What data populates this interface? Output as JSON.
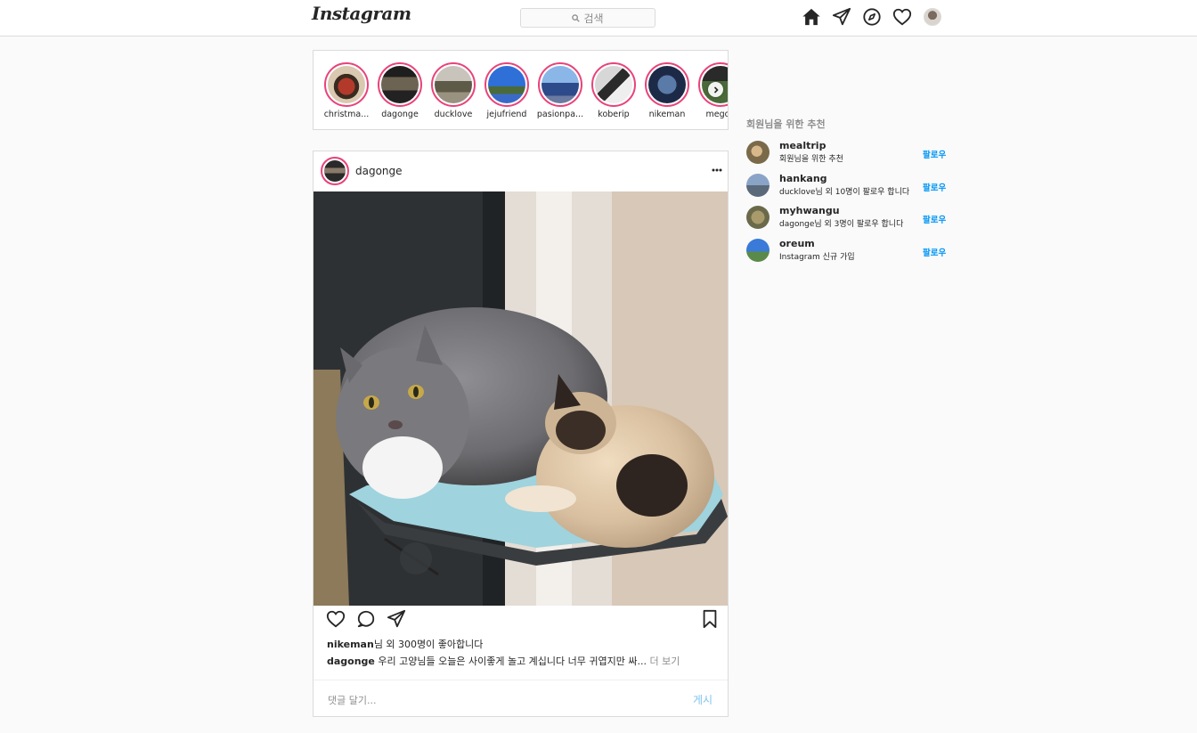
{
  "nav": {
    "logo": "Instagram",
    "search_placeholder": "검색",
    "icons": [
      "home-icon",
      "direct-icon",
      "explore-icon",
      "activity-icon",
      "profile-avatar"
    ]
  },
  "stories": [
    {
      "name": "christma..."
    },
    {
      "name": "dagonge"
    },
    {
      "name": "ducklove"
    },
    {
      "name": "jejufriend"
    },
    {
      "name": "pasionpa..."
    },
    {
      "name": "koberip"
    },
    {
      "name": "nikeman"
    },
    {
      "name": "megod"
    }
  ],
  "post": {
    "username": "dagonge",
    "likes_user": "nikeman",
    "likes_rest": "님 외 300명이 좋아합니다",
    "caption_user": "dagonge",
    "caption_text": " 우리 고양님들 오늘은 사이좋게 놀고 계십니다 너무 귀엽지만 싸...",
    "caption_more": " 더 보기",
    "comment_placeholder": "댓글 달기...",
    "comment_submit": "게시"
  },
  "suggestions": {
    "title": "회원님을 위한 추천",
    "items": [
      {
        "name": "mealtrip",
        "desc": "회원님을 위한 추천",
        "follow": "팔로우"
      },
      {
        "name": "hankang",
        "desc": "ducklove님 외 10명이 팔로우 합니다",
        "follow": "팔로우"
      },
      {
        "name": "myhwangu",
        "desc": "dagonge님 외 3명이 팔로우 합니다",
        "follow": "팔로우"
      },
      {
        "name": "oreum",
        "desc": "Instagram 신규 가입",
        "follow": "팔로우"
      }
    ]
  },
  "colors": {
    "story_ring": "#e8437a",
    "link_blue": "#0095f6",
    "submit_disabled": "#7ec3ee",
    "border": "#dbdbdb",
    "background": "#fafafa"
  }
}
